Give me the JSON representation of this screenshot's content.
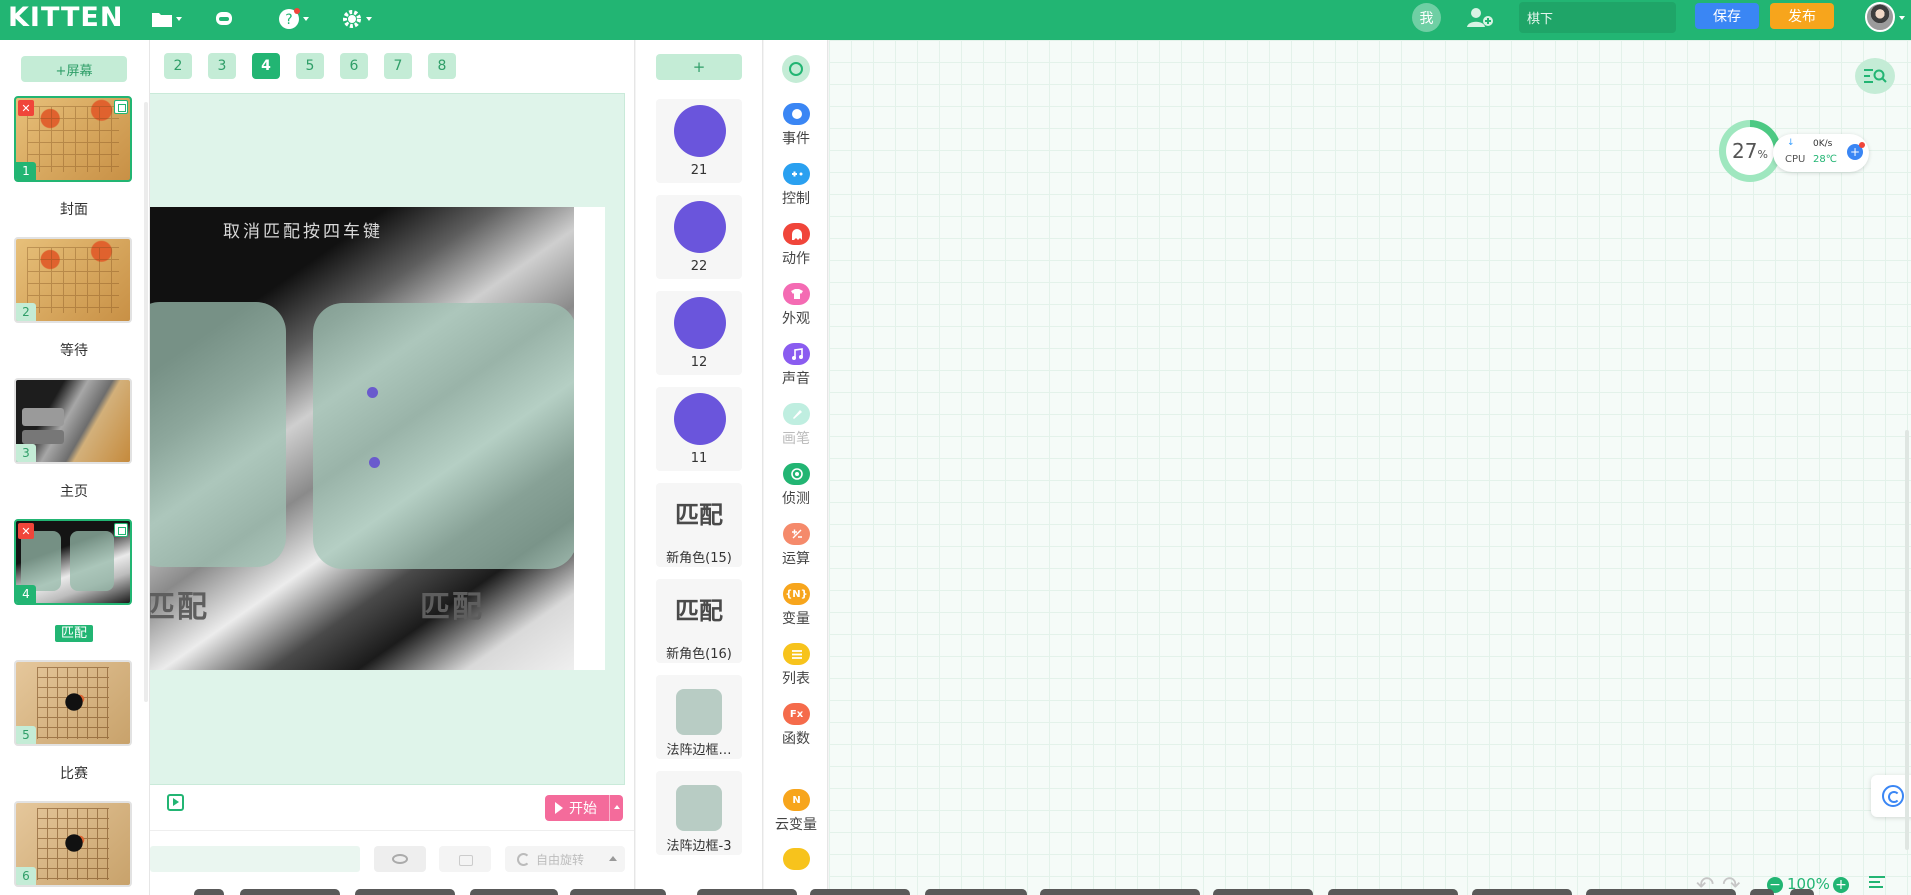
{
  "app": {
    "logo": "KITTEN"
  },
  "topbar": {
    "me_label": "我",
    "project_name": "棋下",
    "save_label": "保存",
    "publish_label": "发布"
  },
  "screens": {
    "add_label": "+屏幕",
    "items": [
      {
        "num": "1",
        "label": "封面"
      },
      {
        "num": "2",
        "label": "等待"
      },
      {
        "num": "3",
        "label": "主页"
      },
      {
        "num": "4",
        "label": "匹配"
      },
      {
        "num": "5",
        "label": "比赛"
      },
      {
        "num": "6",
        "label": ""
      }
    ]
  },
  "stage": {
    "pages": [
      "2",
      "3",
      "4",
      "5",
      "6",
      "7",
      "8"
    ],
    "active_page": "4",
    "image_title": "取消匹配按四车键",
    "match_left": "匹配",
    "match_right": "匹配",
    "start_label": "开始",
    "rotate_label": "自由旋转"
  },
  "roles": {
    "add_label": "+",
    "items": [
      {
        "label": "21"
      },
      {
        "label": "22"
      },
      {
        "label": "12"
      },
      {
        "label": "11"
      },
      {
        "label": "新角色(15)",
        "glyph": "匹配"
      },
      {
        "label": "新角色(16)",
        "glyph": "匹配"
      },
      {
        "label": "法阵边框…"
      },
      {
        "label": "法阵边框-3"
      }
    ],
    "delete_mark": "×"
  },
  "categories": {
    "items": [
      {
        "name": "事件",
        "color": "#3a86f4",
        "icon": "toggle-icon"
      },
      {
        "name": "控制",
        "color": "#2aa0f0",
        "icon": "gamepad-icon"
      },
      {
        "name": "动作",
        "color": "#f0453a",
        "icon": "ghost-icon"
      },
      {
        "name": "外观",
        "color": "#f46bb3",
        "icon": "shirt-icon"
      },
      {
        "name": "声音",
        "color": "#8a5cf0",
        "icon": "music-icon"
      },
      {
        "name": "画笔",
        "color": "#bfeee0",
        "icon": "brush-icon"
      },
      {
        "name": "侦测",
        "color": "#22b573",
        "icon": "target-icon"
      },
      {
        "name": "运算",
        "color": "#f58a6b",
        "icon": "calc-icon"
      },
      {
        "name": "变量",
        "color": "#f7a51c",
        "icon": "variable-icon"
      },
      {
        "name": "列表",
        "color": "#f7c31c",
        "icon": "list-icon"
      },
      {
        "name": "函数",
        "color": "#f56b4b",
        "icon": "function-icon"
      },
      {
        "name": "云变量",
        "color": "#f7a51c",
        "icon": "cloud-variable-icon"
      }
    ],
    "icon_text": {
      "variable": "{N}",
      "function": "Fx",
      "cloud": "N"
    }
  },
  "workspace": {
    "monitor": {
      "percent": "27",
      "percent_unit": "%",
      "net": "0K/s",
      "cpu_label": "CPU",
      "temp": "28℃"
    },
    "zoom": "100%"
  }
}
